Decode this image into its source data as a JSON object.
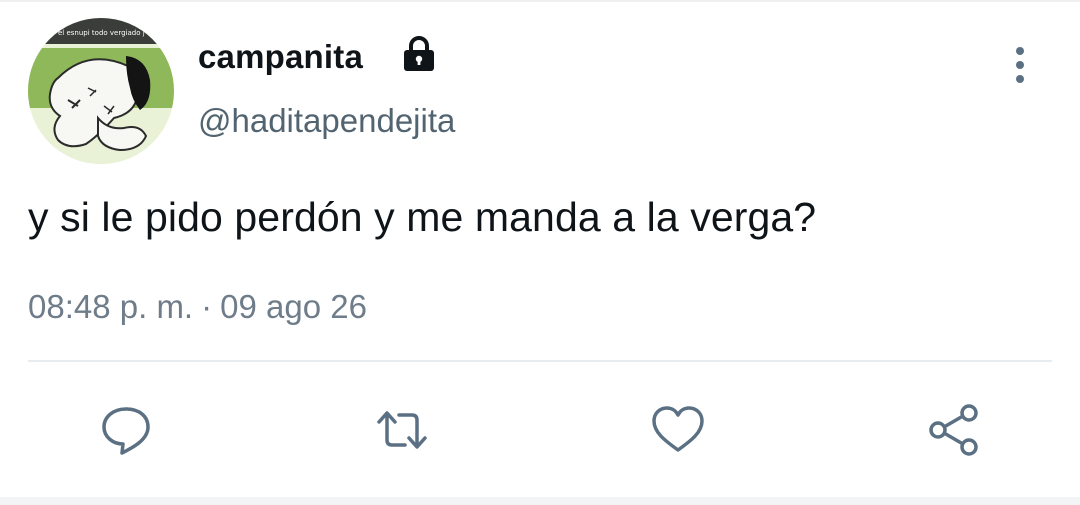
{
  "tweet": {
    "display_name": "campanita",
    "handle": "@haditapendejita",
    "avatar_caption": "el esnupi todo vergiado j",
    "text": "y si le pido perdón y me manda a la verga?",
    "time": "08:48 p. m.",
    "separator": "·",
    "date": "09 ago 26"
  },
  "icons": {
    "protected": "lock-icon",
    "more": "more-vertical-icon",
    "reply": "reply-icon",
    "retweet": "retweet-icon",
    "like": "heart-icon",
    "share": "share-icon"
  },
  "colors": {
    "text": "#0f1419",
    "secondary": "#536471",
    "icon": "#5b7083",
    "divider": "#e6ecf0"
  }
}
